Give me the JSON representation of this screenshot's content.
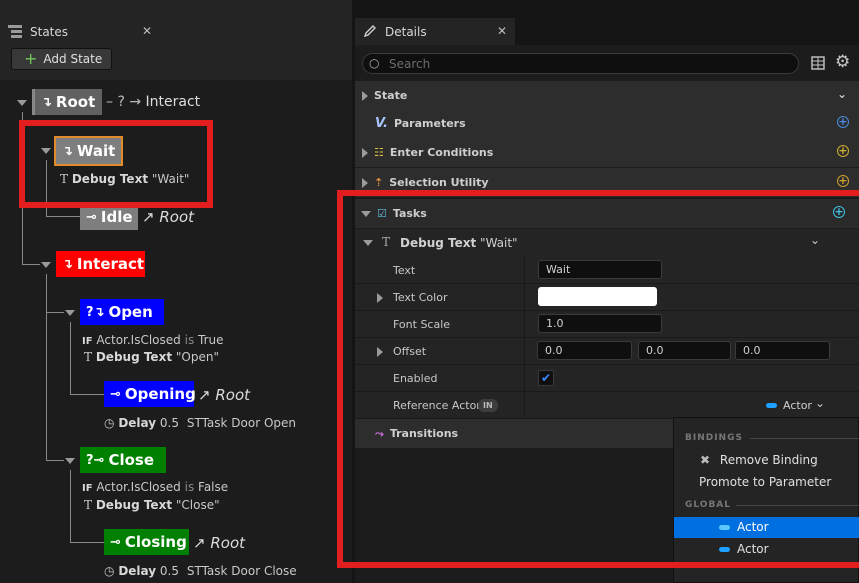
{
  "colors": {
    "root_node": "#616161",
    "wait_node": "#7e7e7e",
    "idle_node": "#7e7e7e",
    "interact_node": "#ff0000",
    "open_node": "#0000ff",
    "close_node": "#008000",
    "highlight_red": "#e21e1e",
    "selected_blue": "#0070e0"
  },
  "states_panel": {
    "tab_title": "States",
    "add_state_label": "Add State",
    "tree": {
      "root": {
        "label": "Root",
        "transition_marker": "?",
        "transition_target": "Interact"
      },
      "wait": {
        "label": "Wait",
        "task_name": "Debug Text",
        "task_value": "\"Wait\""
      },
      "idle": {
        "label": "Idle",
        "target": "Root"
      },
      "interact": {
        "label": "Interact"
      },
      "open": {
        "label": "Open",
        "condition_prefix": "IF",
        "condition_subject": "Actor.IsClosed",
        "condition_op": "is",
        "condition_value": "True",
        "task_name": "Debug Text",
        "task_value": "\"Open\""
      },
      "opening": {
        "label": "Opening",
        "target": "Root",
        "task_name": "Delay",
        "task_value": "0.5",
        "task_extra": "STTask Door Open"
      },
      "close": {
        "label": "Close",
        "condition_prefix": "IF",
        "condition_subject": "Actor.IsClosed",
        "condition_op": "is",
        "condition_value": "False",
        "task_name": "Debug Text",
        "task_value": "\"Close\""
      },
      "closing": {
        "label": "Closing",
        "target": "Root",
        "task_name": "Delay",
        "task_value": "0.5",
        "task_extra": "STTask Door Close"
      }
    }
  },
  "details_panel": {
    "tab_title": "Details",
    "search_placeholder": "Search",
    "categories": {
      "state": "State",
      "parameters": "Parameters",
      "enter_conditions": "Enter Conditions",
      "selection_utility": "Selection Utility",
      "tasks": "Tasks",
      "transitions": "Transitions"
    },
    "task": {
      "name": "Debug Text",
      "value": "\"Wait\"",
      "properties": {
        "text_label": "Text",
        "text_value": "Wait",
        "text_color_label": "Text Color",
        "font_scale_label": "Font Scale",
        "font_scale_value": "1.0",
        "offset_label": "Offset",
        "offset_x": "0.0",
        "offset_y": "0.0",
        "offset_z": "0.0",
        "enabled_label": "Enabled",
        "reference_actor_label": "Reference Actor",
        "reference_actor_badge": "IN",
        "reference_actor_value": "Actor"
      }
    },
    "binding_menu": {
      "bindings_header": "BINDINGS",
      "remove_binding": "Remove Binding",
      "promote_to_parameter": "Promote to Parameter",
      "global_header": "GLOBAL",
      "items": [
        "Actor",
        "Actor"
      ]
    }
  }
}
